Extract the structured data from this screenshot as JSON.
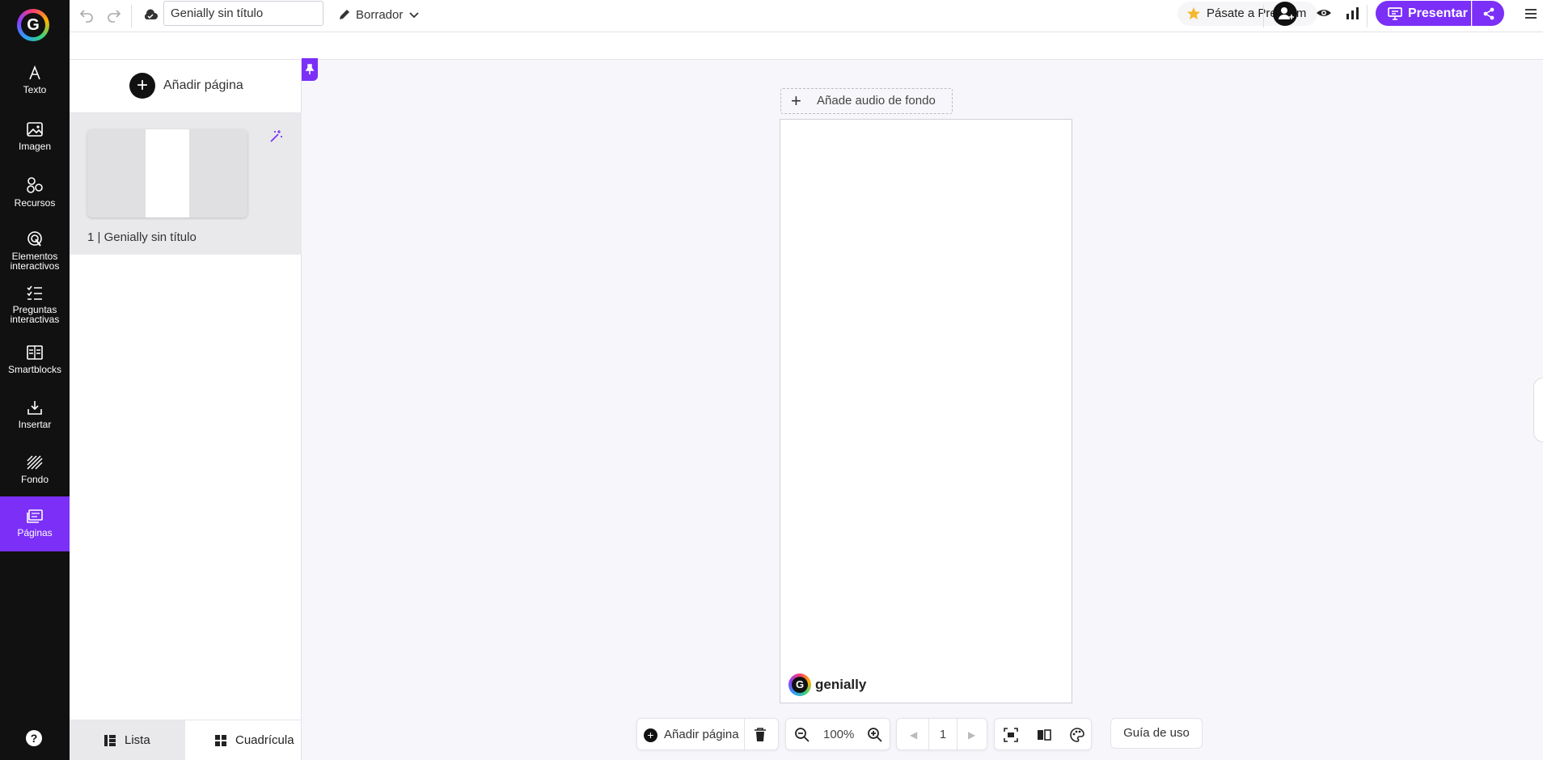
{
  "app": {
    "logo_letter": "G",
    "accent_color": "#7b2ff7"
  },
  "rail": {
    "items": [
      {
        "label": "Texto",
        "icon": "text-icon"
      },
      {
        "label": "Imagen",
        "icon": "image-icon"
      },
      {
        "label": "Recursos",
        "icon": "resources-icon"
      },
      {
        "label": "Elementos interactivos",
        "icon": "interactive-elements-icon"
      },
      {
        "label": "Preguntas interactivas",
        "icon": "checklist-icon"
      },
      {
        "label": "Smartblocks",
        "icon": "smartblocks-icon"
      },
      {
        "label": "Insertar",
        "icon": "insert-icon"
      },
      {
        "label": "Fondo",
        "icon": "background-icon"
      },
      {
        "label": "Páginas",
        "icon": "pages-icon",
        "active": true
      }
    ],
    "help_label": "?"
  },
  "toolbar": {
    "title_value": "Genially sin título",
    "draft_label": "Borrador",
    "premium_label": "Pásate a Premium",
    "present_label": "Presentar"
  },
  "panel": {
    "add_page_label": "Añadir página",
    "pages": [
      {
        "number": "1 |",
        "title": "Genially sin título"
      }
    ],
    "tabs": {
      "list_label": "Lista",
      "grid_label": "Cuadrícula"
    }
  },
  "canvas": {
    "audio_label": "Añade audio de fondo",
    "brand_label": "genially"
  },
  "bottom": {
    "add_page_label": "Añadir página",
    "zoom": "100%",
    "page_number": "1",
    "guide_label": "Guía de uso"
  }
}
